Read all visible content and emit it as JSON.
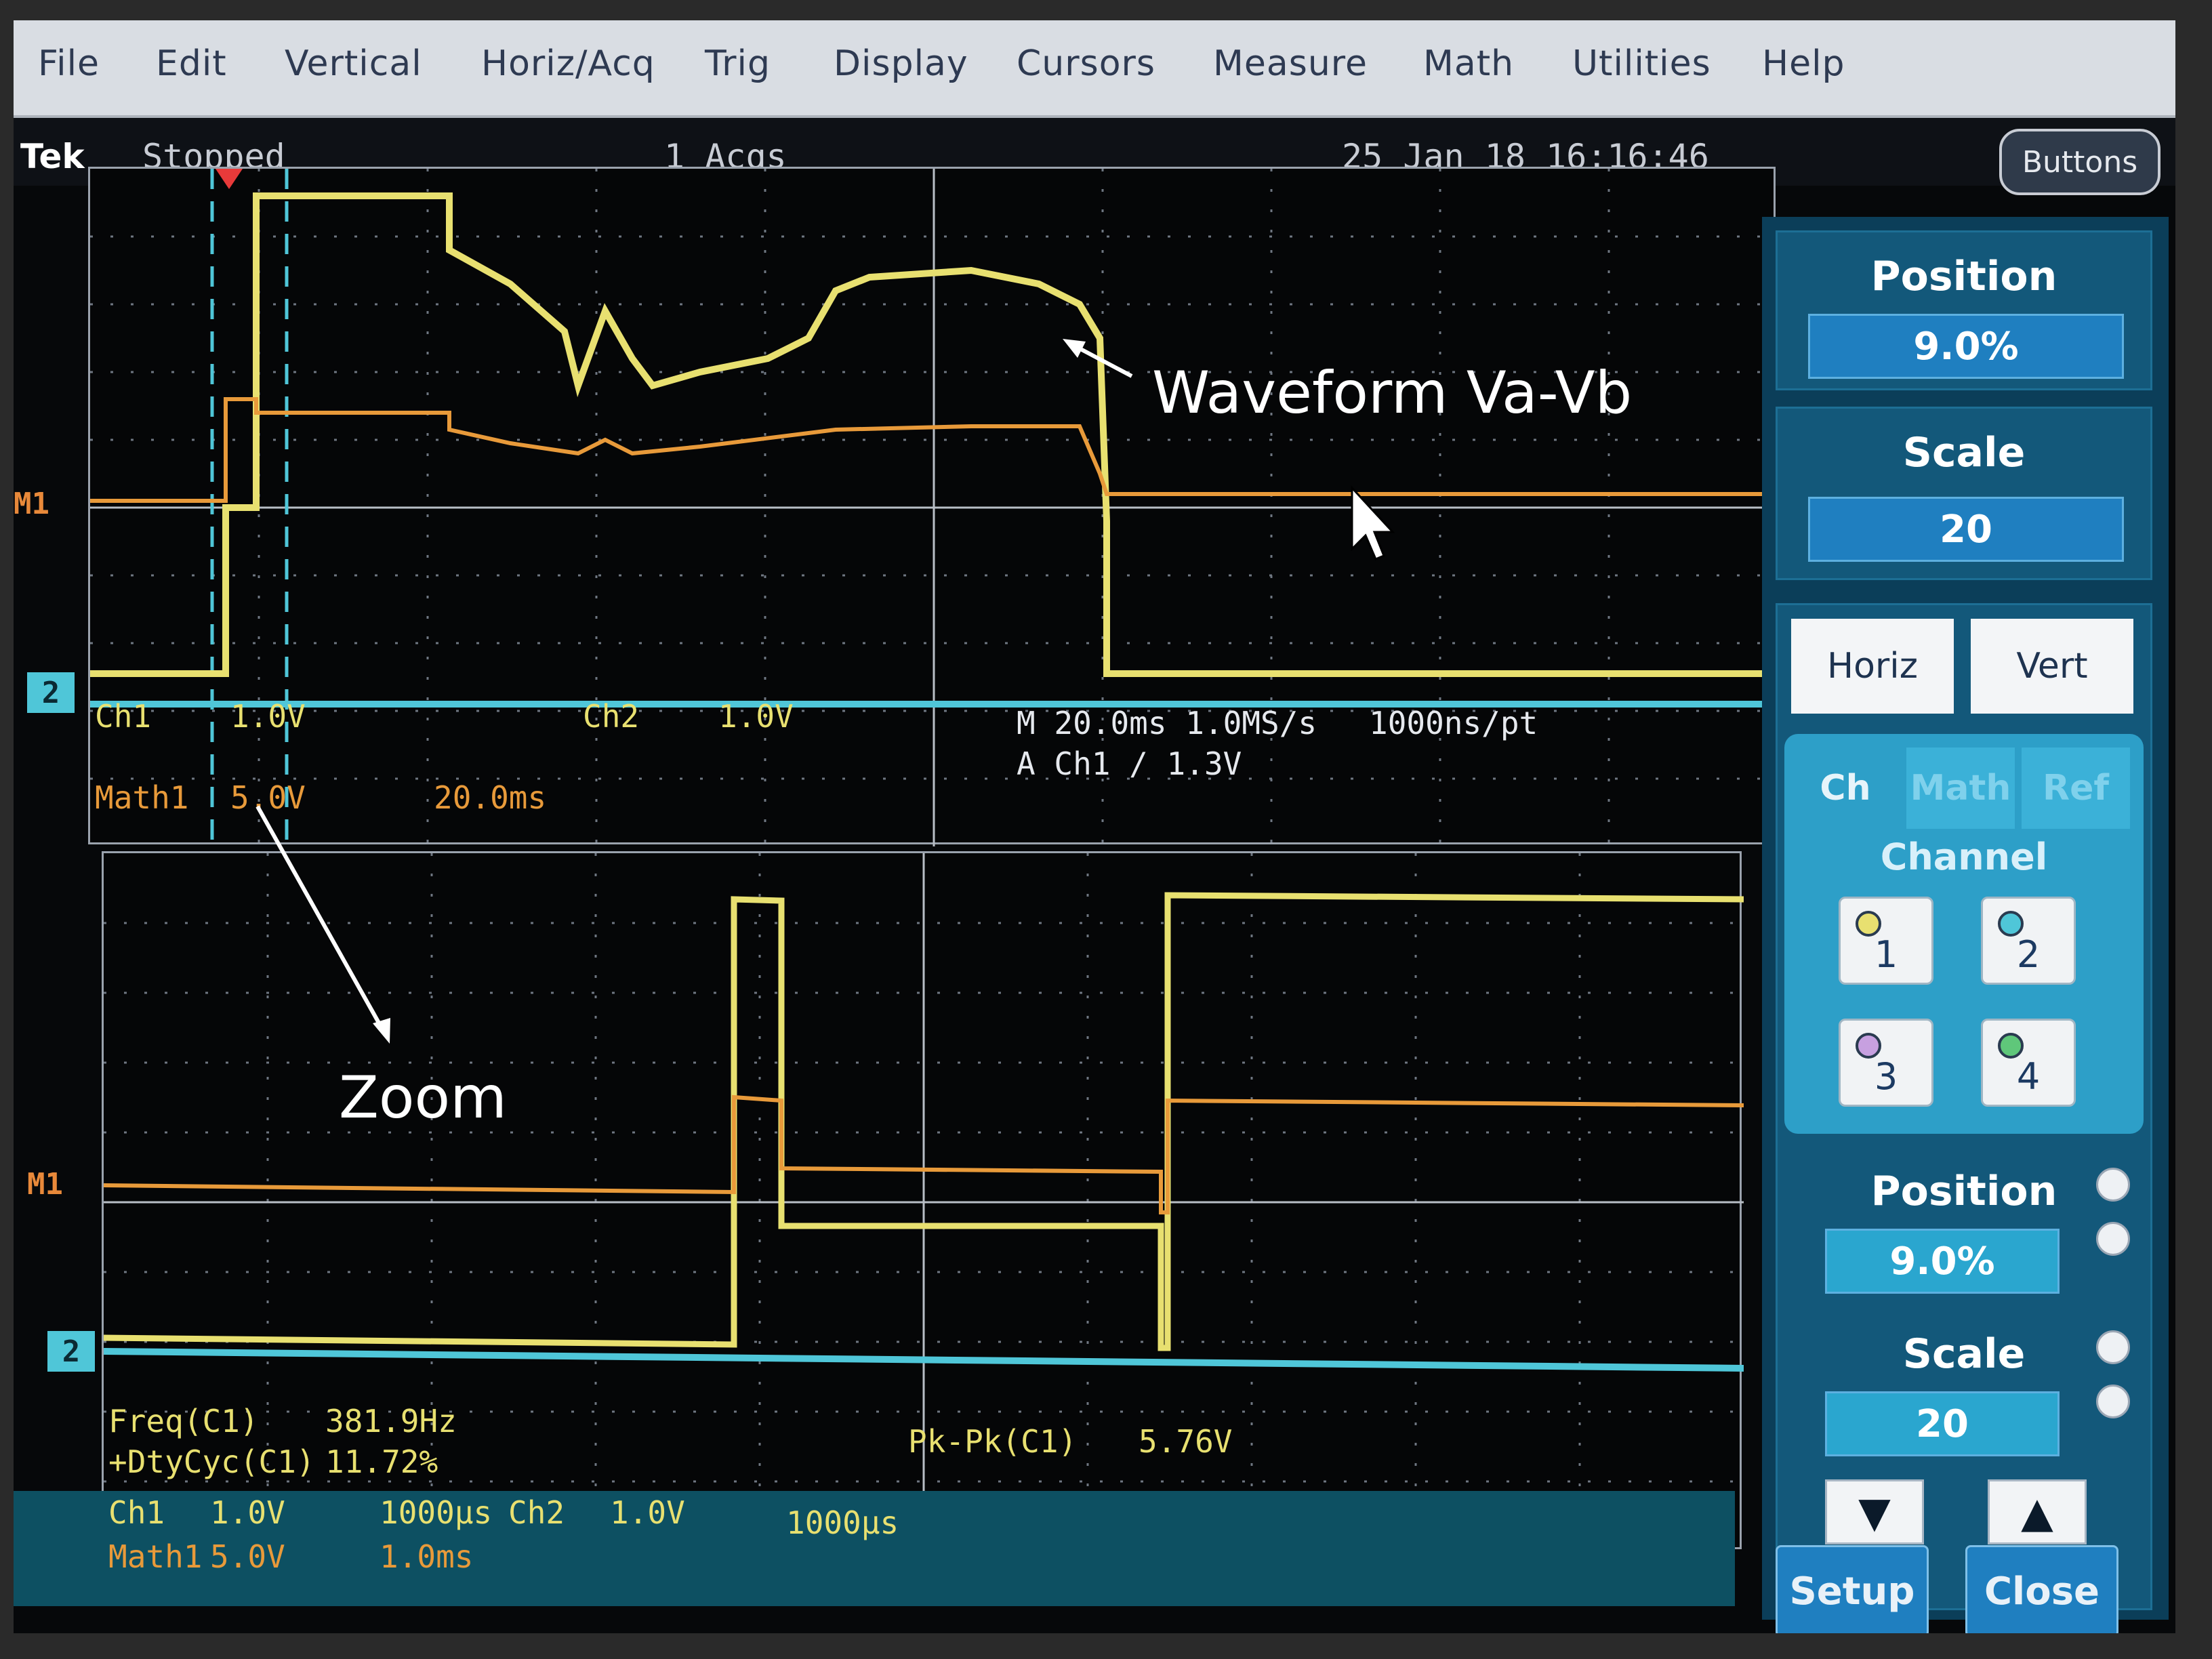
{
  "menu": [
    "File",
    "Edit",
    "Vertical",
    "Horiz/Acq",
    "Trig",
    "Display",
    "Cursors",
    "Measure",
    "Math",
    "Utilities",
    "Help"
  ],
  "status": {
    "brand": "Tek",
    "run_state": "Stopped",
    "acqs": "1 Acqs",
    "datetime": "25 Jan 18 16:16:46",
    "buttons_label": "Buttons"
  },
  "main_readout": {
    "ch1": "Ch1",
    "ch1_scale": "1.0V",
    "ch2": "Ch2",
    "ch2_scale": "1.0V",
    "math1": "Math1",
    "math1_scale": "5.0V",
    "math1_time": "20.0ms",
    "timebase": "M 20.0ms 1.0MS/s",
    "resolution": "1000ns/pt",
    "trigger": "A  Ch1  ∕  1.3V"
  },
  "markers": {
    "m1": "M1",
    "ch2": "2"
  },
  "zoom_readout": {
    "freq_label": "Freq(C1)",
    "freq_value": "381.9Hz",
    "duty_label": "+DtyCyc(C1)",
    "duty_value": "11.72%",
    "pkpk_label": "Pk-Pk(C1)",
    "pkpk_value": "5.76V",
    "ch1": "Ch1",
    "ch1_scale": "1.0V",
    "time1": "1000µs",
    "ch2": "Ch2",
    "ch2_scale": "1.0V",
    "time2": "1000µs",
    "math1": "Math1",
    "math1_scale": "5.0V",
    "math1_time": "1.0ms"
  },
  "side_panel": {
    "position_title": "Position",
    "position_value": "9.0%",
    "scale_title": "Scale",
    "scale_value": "20",
    "tab_horiz": "Horiz",
    "tab_vert": "Vert",
    "tab_ch": "Ch",
    "tab_math": "Math",
    "tab_ref": "Ref",
    "channel_title": "Channel",
    "channels": [
      "1",
      "2",
      "3",
      "4"
    ],
    "position2_title": "Position",
    "position2_value": "9.0%",
    "scale2_title": "Scale",
    "scale2_value": "20",
    "setup_label": "Setup",
    "close_label": "Close"
  },
  "annotations": {
    "waveform": "Waveform Va-Vb",
    "zoom": "Zoom"
  },
  "colors": {
    "ch1": "#e8e070",
    "math": "#e8893a",
    "ch2": "#4fc6d8",
    "grid": "#7f8894"
  }
}
